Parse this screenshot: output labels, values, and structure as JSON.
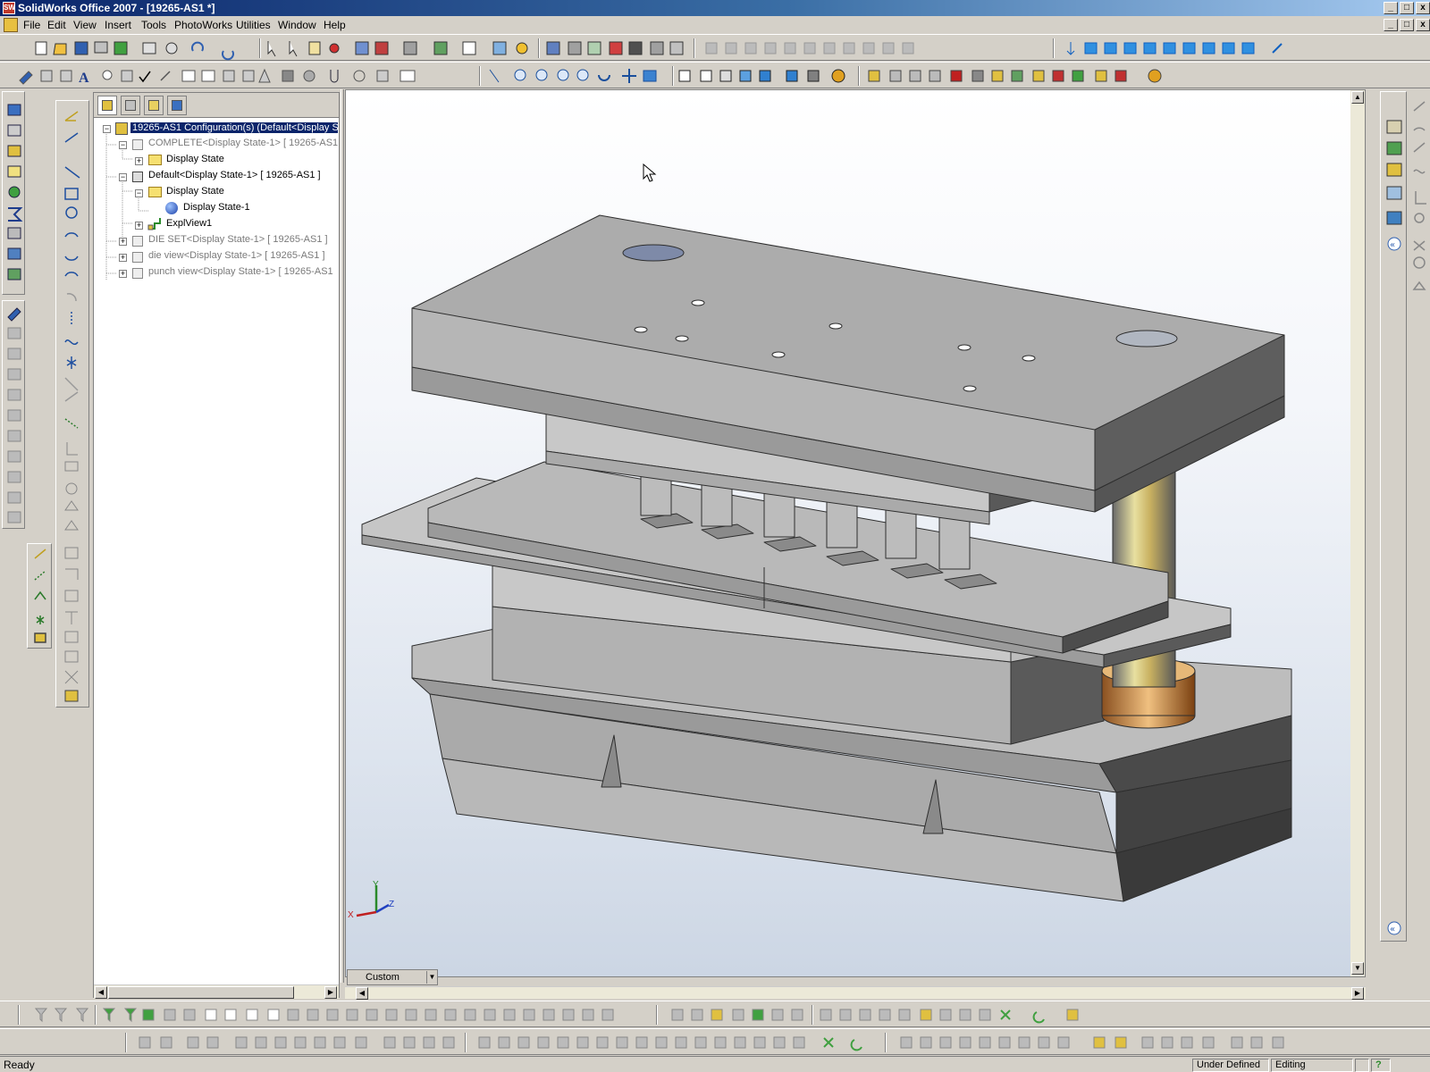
{
  "window": {
    "title": "SolidWorks Office 2007 - [19265-AS1 *]",
    "app_icon": "SW"
  },
  "menu": {
    "items": [
      "File",
      "Edit",
      "View",
      "Insert",
      "Tools",
      "PhotoWorks",
      "Utilities",
      "Window",
      "Help"
    ]
  },
  "tree": {
    "root": "19265-AS1 Configuration(s)  (Default<Display S",
    "items": [
      {
        "label": "COMPLETE<Display State-1> [ 19265-AS1 ]"
      },
      {
        "label": "Display State"
      },
      {
        "label": "Default<Display State-1> [ 19265-AS1 ]"
      },
      {
        "label": "Display State"
      },
      {
        "label": "Display State-1"
      },
      {
        "label": "ExplView1"
      },
      {
        "label": "DIE SET<Display State-1> [ 19265-AS1 ]"
      },
      {
        "label": "die view<Display State-1> [ 19265-AS1 ]"
      },
      {
        "label": "punch view<Display State-1> [ 19265-AS1"
      }
    ]
  },
  "viewport": {
    "view_combo": "Custom",
    "triad": {
      "x": "X",
      "y": "Y",
      "z": "Z"
    }
  },
  "status": {
    "left": "Ready",
    "state": "Under Defined",
    "mode": "Editing Assembly",
    "help": "?"
  },
  "colors": {
    "title_start": "#0a246a",
    "title_end": "#a6caf0",
    "tree_selected": "#0a246a",
    "part_gray": "#a6a6a6"
  }
}
